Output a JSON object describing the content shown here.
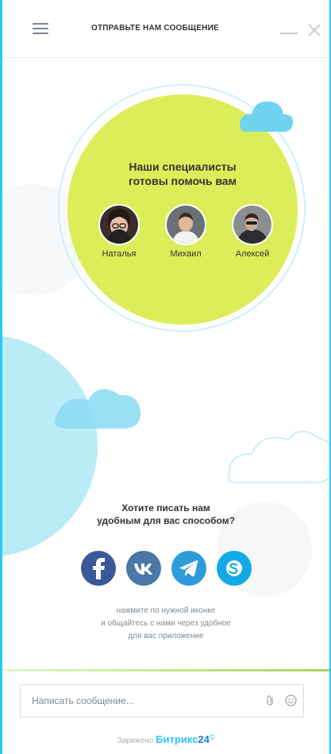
{
  "header": {
    "title": "ОТПРАВЬТЕ НАМ СООБЩЕНИЕ",
    "menu_icon": "hamburger-icon",
    "minimize_icon": "minimize-icon",
    "close_icon": "close-icon"
  },
  "team": {
    "title_line1": "Наши специалисты",
    "title_line2": "готовы помочь вам",
    "members": [
      {
        "name": "Наталья"
      },
      {
        "name": "Михаил"
      },
      {
        "name": "Алексей"
      }
    ]
  },
  "channels": {
    "question_line1": "Хотите писать нам",
    "question_line2": "удобным для вас способом?",
    "items": [
      {
        "name": "facebook",
        "color": "#3b5998"
      },
      {
        "name": "vk",
        "color": "#4a76a8"
      },
      {
        "name": "telegram",
        "color": "#2d9bd9"
      },
      {
        "name": "skype",
        "color": "#12a9e6"
      }
    ],
    "hint_line1": "нажмите по нужной иконке",
    "hint_line2": "и общайтесь с нами через удобное",
    "hint_line3": "для вас приложение"
  },
  "composer": {
    "placeholder": "Написать сообщение...",
    "attach_icon": "paperclip-icon",
    "emoji_icon": "smile-icon"
  },
  "footer": {
    "prefix": "Заряжено",
    "brand": "Битрикс",
    "brand_num": "24",
    "mark": "©"
  },
  "colors": {
    "accent": "#2fc6f6",
    "team_circle": "#dbee59"
  }
}
